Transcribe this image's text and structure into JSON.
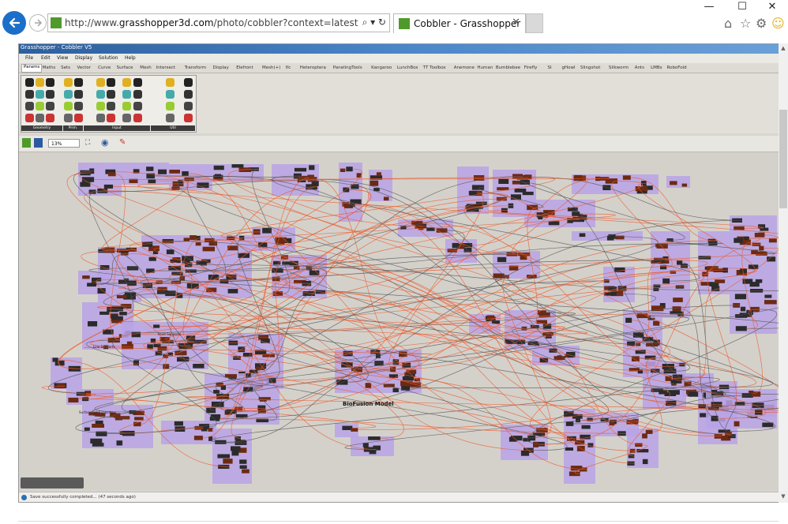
{
  "browser": {
    "url_prefix": "http://www.",
    "url_host": "grasshopper3d.com",
    "url_path": "/photo/cobbler?context=latest",
    "tab_title": "Cobbler - Grasshopper",
    "window_controls": {
      "minimize": "—",
      "maximize": "☐",
      "close": "✕"
    },
    "address_icons": "⌕ ▾ ↻",
    "right_icons": [
      "home-icon",
      "star-icon",
      "gear-icon",
      "smiley-icon"
    ]
  },
  "grasshopper": {
    "title": "Grasshopper - Cobbler V5",
    "menu": [
      "File",
      "Edit",
      "View",
      "Display",
      "Solution",
      "Help"
    ],
    "tabs": [
      "Params",
      "Maths",
      "Sets",
      "Vector",
      "Curve",
      "Surface",
      "Mesh",
      "Intersect",
      "Transform",
      "Display",
      "Elefront",
      "Mesh(+)",
      "Ifc",
      "Heteroptera",
      "PanelingTools",
      "Kangaroo",
      "LunchBox",
      "TT Toolbox",
      "Anemone",
      "Human",
      "Bumblebee",
      "Firefly",
      "SI",
      "gHowl",
      "Slingshot",
      "Silkworm",
      "Ants",
      "LMBs",
      "RoboFold"
    ],
    "active_tab": "Params",
    "ribbon_groups": [
      "Geometry",
      "Prim.",
      "Input",
      "Util"
    ],
    "zoom": "13%",
    "canvas_label": "BioFusion Model",
    "group_labels": [
      "Point Supports",
      "Line Supports",
      "Surface Out Supports"
    ],
    "status": "Save successfully completed... (47 seconds ago)"
  },
  "colors": {
    "accent": "#1b6fc9",
    "group_purple": "#b9a3e6",
    "wire_orange": "#ee5a2b",
    "wire_gray": "#555555",
    "canvas_bg": "#d4d1cb"
  }
}
